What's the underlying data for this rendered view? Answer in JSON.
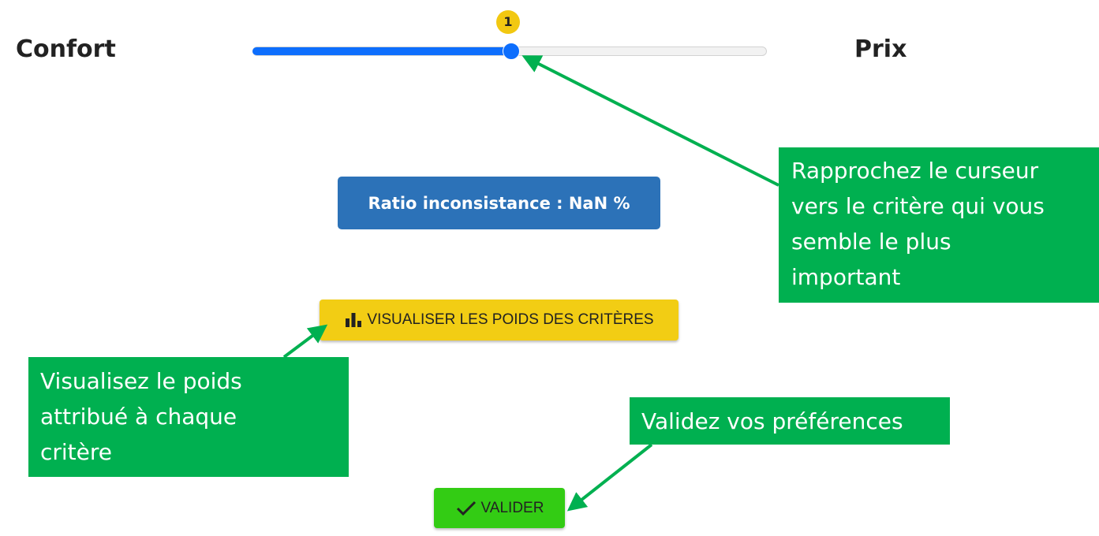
{
  "criteria": {
    "left_label": "Confort",
    "right_label": "Prix"
  },
  "slider": {
    "value_label": "1",
    "value_fraction": 0.5,
    "accent": "#0d6efd",
    "bubble_color": "#f2c811"
  },
  "ratio": {
    "label": "Ratio inconsistance : NaN %",
    "color": "#2c72b8"
  },
  "buttons": {
    "weights_label": "VISUALISER LES POIDS DES CRITÈRES",
    "weights_icon": "bar-chart-icon",
    "weights_color": "#f2cd14",
    "validate_label": "VALIDER",
    "validate_icon": "check-icon",
    "validate_color": "#33cc14"
  },
  "annotations": {
    "slider_lines": [
      "Rapprochez le curseur",
      "vers le critère qui vous",
      "semble le plus",
      "important"
    ],
    "weights_lines": [
      "Visualisez le poids",
      "attribué à chaque",
      "critère"
    ],
    "validate_lines": [
      "Validez vos préférences"
    ],
    "color": "#00b050"
  }
}
